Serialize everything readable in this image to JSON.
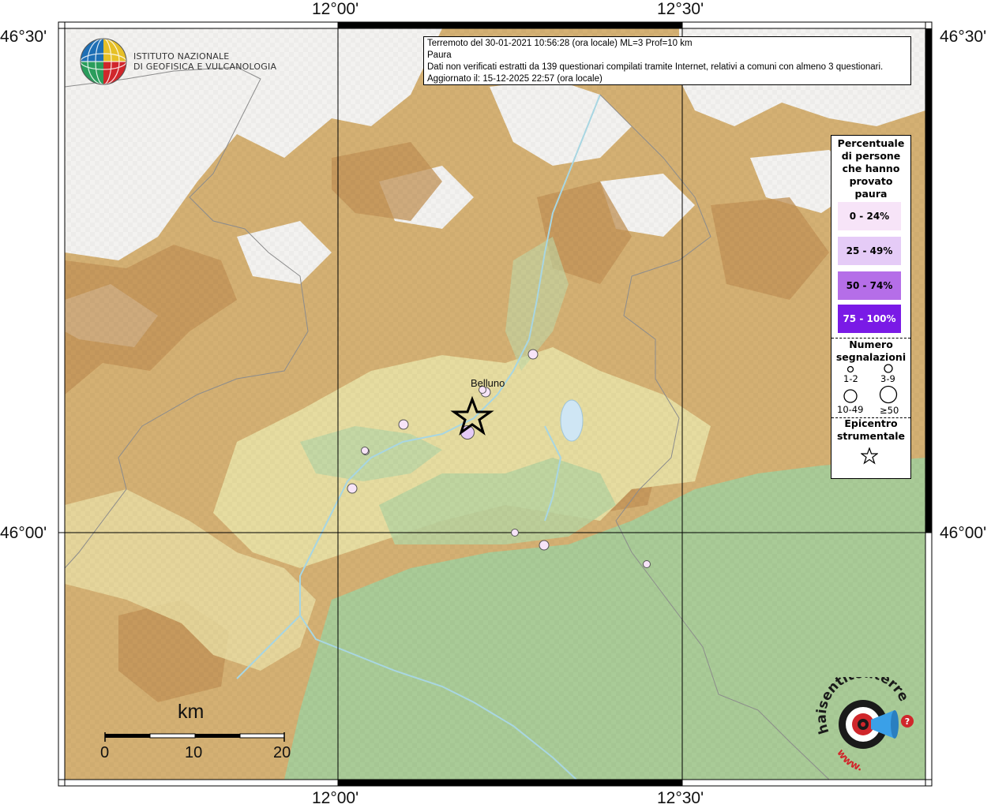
{
  "header": {
    "line1": "Terremoto del 30-01-2021 10:56:28 (ora locale) ML=3 Prof=10 km",
    "line2": "Paura",
    "line3": "Dati non verificati estratti da 139 questionari compilati tramite Internet, relativi a comuni con almeno 3 questionari.",
    "line4": "Aggiornato il: 15-12-2025 22:57 (ora locale)"
  },
  "coords": {
    "top_left_lon": "12°00'",
    "top_right_lon": "12°30'",
    "left_top_lat": "46°30'",
    "left_bottom_lat": "46°00'",
    "right_top_lat": "46°30'",
    "right_bottom_lat": "46°00'",
    "bottom_left_lon": "12°00'",
    "bottom_right_lon": "12°30'"
  },
  "logo_ingv": {
    "line1": "ISTITUTO NAZIONALE",
    "line2": "DI GEOFISICA E VULCANOLOGIA"
  },
  "city": {
    "name": "Belluno"
  },
  "legend": {
    "title_lines": [
      "Percentuale",
      "di persone",
      "che hanno",
      "provato",
      "paura"
    ],
    "classes": [
      {
        "label": "0 - 24%",
        "color": "#f7e4f8",
        "text_color": "#000000"
      },
      {
        "label": "25 - 49%",
        "color": "#e5cbf7",
        "text_color": "#000000"
      },
      {
        "label": "50 - 74%",
        "color": "#b56ee8",
        "text_color": "#000000"
      },
      {
        "label": "75 - 100%",
        "color": "#7a1ae6",
        "text_color": "#ffffff"
      }
    ],
    "count_title_lines": [
      "Numero",
      "segnalazioni"
    ],
    "count_classes": [
      "1-2",
      "3-9",
      "10-49",
      "≥50"
    ],
    "epicenter_title_lines": [
      "Epicentro",
      "strumentale"
    ],
    "epicenter_icon": "star-icon"
  },
  "scale": {
    "unit": "km",
    "ticks": [
      "0",
      "10",
      "20"
    ]
  },
  "watermark": {
    "name": "haisentitoilterremoto.it",
    "text_it": "haisentitoilterremoto.it",
    "text_www": "www.",
    "icon": "ear-speaker-icon"
  },
  "observations": [
    {
      "category": "0 - 24%",
      "count_class": "3-9"
    },
    {
      "category": "0 - 24%",
      "count_class": "3-9"
    },
    {
      "category": "0 - 24%",
      "count_class": "3-9"
    },
    {
      "category": "0 - 24%",
      "count_class": "1-2"
    },
    {
      "category": "0 - 24%",
      "count_class": "3-9"
    },
    {
      "category": "25 - 49%",
      "count_class": "10-49"
    },
    {
      "category": "0 - 24%",
      "count_class": "1-2"
    },
    {
      "category": "0 - 24%",
      "count_class": "3-9"
    },
    {
      "category": "0 - 24%",
      "count_class": "1-2"
    },
    {
      "category": "0 - 24%",
      "count_class": "1-2"
    },
    {
      "category": "0 - 24%",
      "count_class": "1-2"
    }
  ],
  "colors": {
    "plain_green": "#a9cb97",
    "hill_yellow": "#e9e1a7",
    "mountain_brown": "#c9a062",
    "snow": "#f4f4f4",
    "river": "#a8d6e2",
    "lake": "#cfe6f4",
    "watermark_red": "#d0262b"
  }
}
